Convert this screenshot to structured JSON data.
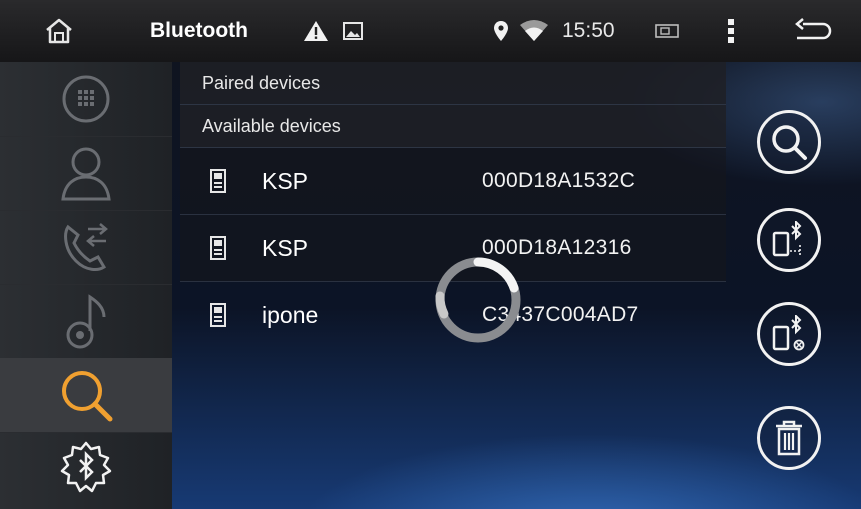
{
  "status_bar": {
    "title": "Bluetooth",
    "time": "15:50",
    "icons": [
      "home-icon",
      "warning-icon",
      "image-icon",
      "location-icon",
      "wifi-icon",
      "battery-icon",
      "more-vert-icon",
      "back-icon"
    ]
  },
  "sidebar": {
    "items": [
      {
        "name": "keypad",
        "icon": "dialpad-icon",
        "active": false
      },
      {
        "name": "contacts",
        "icon": "contact-icon",
        "active": false
      },
      {
        "name": "call-log",
        "icon": "call-transfer-icon",
        "active": false
      },
      {
        "name": "music",
        "icon": "music-note-icon",
        "active": false
      },
      {
        "name": "search",
        "icon": "search-icon",
        "active": true
      },
      {
        "name": "bluetooth-settings",
        "icon": "bluetooth-gear-icon",
        "active": false
      }
    ]
  },
  "list": {
    "paired_header": "Paired devices",
    "available_header": "Available devices",
    "devices": [
      {
        "name": "KSP",
        "address": "000D18A1532C"
      },
      {
        "name": "KSP",
        "address": "000D18A12316"
      },
      {
        "name": "ipone",
        "address": "C3437C004AD7"
      }
    ]
  },
  "right_actions": [
    "search-icon",
    "phone-bluetooth-connect-icon",
    "phone-bluetooth-disconnect-icon",
    "trash-icon"
  ],
  "colors": {
    "accent": "#f0a030",
    "background_blue": "#173a74"
  }
}
